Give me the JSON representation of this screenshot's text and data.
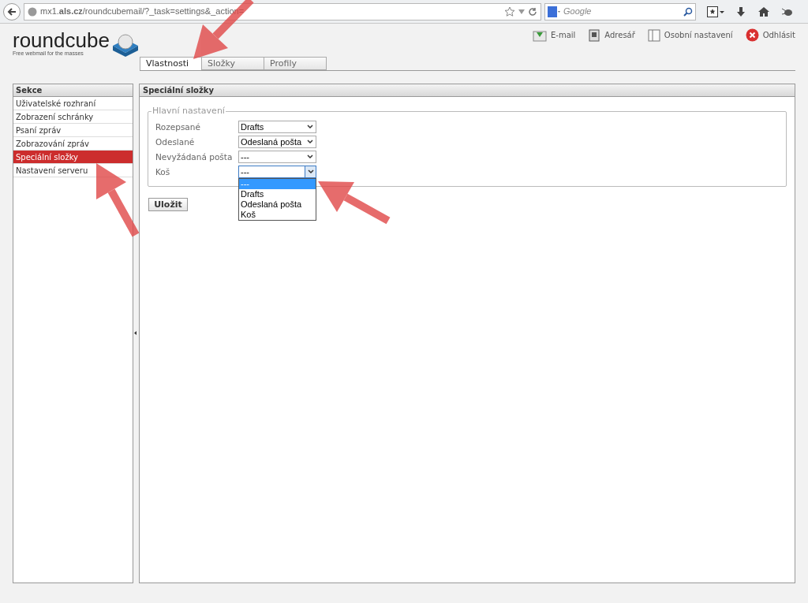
{
  "browser": {
    "url": "mx1.**als.cz**/roundcubemail/?_task=settings&_action=",
    "search_placeholder": "Google"
  },
  "logo": {
    "name": "roundcube",
    "tagline": "Free webmail for the masses"
  },
  "top_nav": [
    {
      "kind": "mail",
      "label": "E-mail"
    },
    {
      "kind": "addressbook",
      "label": "Adresář"
    },
    {
      "kind": "settings",
      "label": "Osobní nastavení"
    },
    {
      "kind": "logout",
      "label": "Odhlásit"
    }
  ],
  "tabs": [
    {
      "label": "Vlastnosti",
      "selected": true
    },
    {
      "label": "Složky",
      "selected": false
    },
    {
      "label": "Profily",
      "selected": false
    }
  ],
  "sidebar": {
    "title": "Sekce",
    "items": [
      {
        "label": "Uživatelské rozhraní",
        "selected": false
      },
      {
        "label": "Zobrazení schránky",
        "selected": false
      },
      {
        "label": "Psaní zpráv",
        "selected": false
      },
      {
        "label": "Zobrazování zpráv",
        "selected": false
      },
      {
        "label": "Speciální složky",
        "selected": true
      },
      {
        "label": "Nastavení serveru",
        "selected": false
      }
    ]
  },
  "panel": {
    "title": "Speciální složky",
    "legend": "Hlavní nastavení",
    "rows": [
      {
        "label": "Rozepsané",
        "value": "Drafts",
        "open": false
      },
      {
        "label": "Odeslané",
        "value": "Odeslaná pošta",
        "open": false
      },
      {
        "label": "Nevyžádaná pošta",
        "value": "---",
        "open": false
      },
      {
        "label": "Koš",
        "value": "---",
        "open": true,
        "options": [
          {
            "label": "---",
            "selected": true
          },
          {
            "label": "Drafts",
            "selected": false
          },
          {
            "label": "Odeslaná pošta",
            "selected": false
          },
          {
            "label": "Koš",
            "selected": false
          }
        ]
      }
    ],
    "save_button": "Uložit"
  }
}
